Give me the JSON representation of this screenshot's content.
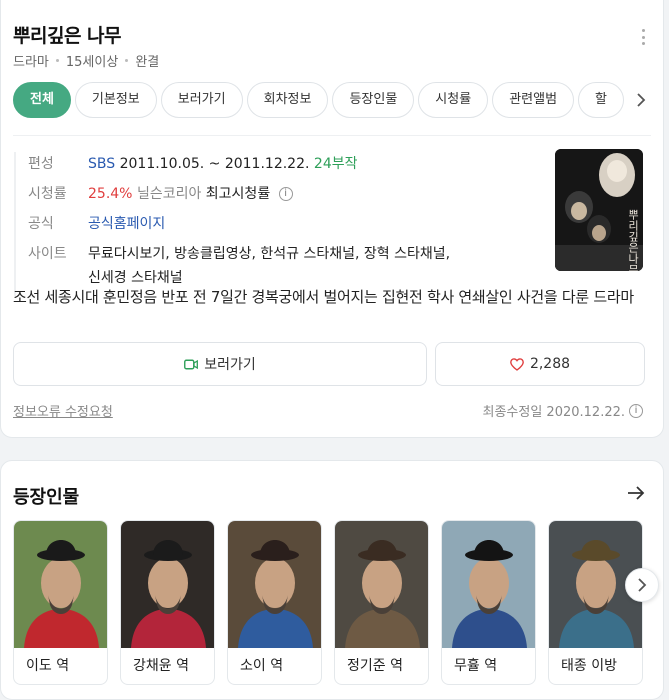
{
  "header": {
    "title": "뿌리깊은 나무",
    "genre": "드라마",
    "rating": "15세이상",
    "status": "완결"
  },
  "tabs": [
    {
      "label": "전체",
      "active": true
    },
    {
      "label": "기본정보"
    },
    {
      "label": "보러가기"
    },
    {
      "label": "회차정보"
    },
    {
      "label": "등장인물"
    },
    {
      "label": "시청률"
    },
    {
      "label": "관련앨범"
    },
    {
      "label": "할"
    }
  ],
  "info": {
    "broadcast": {
      "label": "편성",
      "channel": "SBS",
      "dates": "2011.10.05. ~ 2011.12.22.",
      "episodes": "24부작"
    },
    "viewership": {
      "label": "시청률",
      "value": "25.4%",
      "source": "닐슨코리아",
      "note": "최고시청률"
    },
    "official": {
      "label": "공식",
      "link": "공식홈페이지"
    },
    "sites": {
      "label": "사이트",
      "line1": "무료다시보기, 방송클립영상, 한석규 스타채널, 장혁 스타채널,",
      "line2": "신세경 스타채널"
    }
  },
  "description": "조선 세종시대 훈민정음 반포 전 7일간 경복궁에서 벌어지는 집현전 학사 연쇄살인 사건을 다룬 드라마",
  "actions": {
    "watch_label": "보러가기",
    "like_count": "2,288"
  },
  "footer": {
    "report_label": "정보오류 수정요청",
    "last_modified": "최종수정일 2020.12.22."
  },
  "cast": {
    "title": "등장인물",
    "items": [
      {
        "name": "이도 역",
        "hat": "#1a1a1a",
        "robe": "#c0282e",
        "bg": "#6d8a4f"
      },
      {
        "name": "강채윤 역",
        "hat": "#1b1b1b",
        "robe": "#b3253a",
        "bg": "#2f2a27"
      },
      {
        "name": "소이 역",
        "hat": "#2a1f1c",
        "robe": "#2f5c9e",
        "bg": "#5a4b3a"
      },
      {
        "name": "정기준 역",
        "hat": "#3a2c22",
        "robe": "#6e5a44",
        "bg": "#4f4a42"
      },
      {
        "name": "무휼 역",
        "hat": "#141414",
        "robe": "#2e4f8c",
        "bg": "#8fa8b6"
      },
      {
        "name": "태종 이방",
        "hat": "#5a4a2a",
        "robe": "#3b6f8a",
        "bg": "#4a4f52"
      }
    ]
  },
  "colors": {
    "accent": "#45a982",
    "link": "#2a5ab0",
    "episodes": "#2e9f59",
    "rating": "#e03e3e"
  }
}
